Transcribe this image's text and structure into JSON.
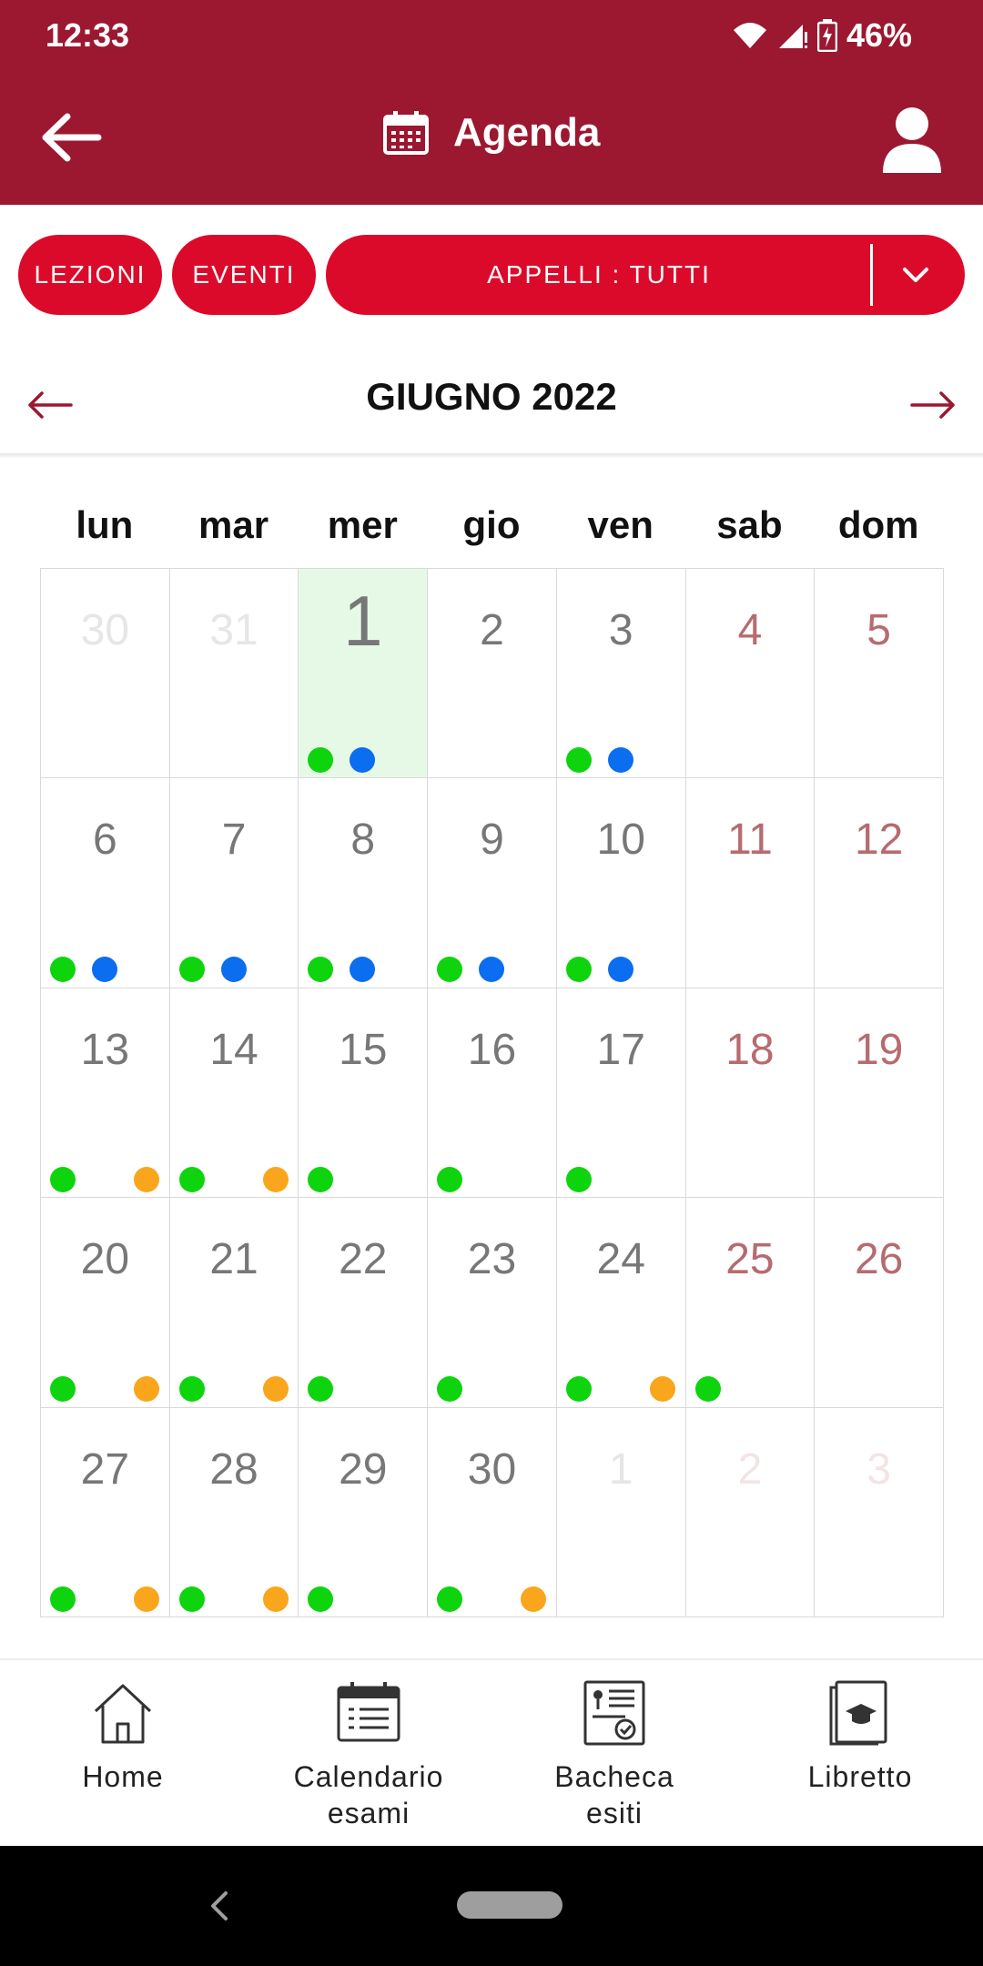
{
  "status_bar": {
    "time": "12:33",
    "battery": "46%"
  },
  "app_bar": {
    "title": "Agenda"
  },
  "filters": {
    "lezioni": "LEZIONI",
    "eventi": "EVENTI",
    "appelli": "APPELLI : TUTTI"
  },
  "month_nav": {
    "title": "GIUGNO 2022"
  },
  "weekdays": [
    "lun",
    "mar",
    "mer",
    "gio",
    "ven",
    "sab",
    "dom"
  ],
  "colors": {
    "lezioni_dot": "#0ed40e",
    "eventi_dot": "#0b6df0",
    "appelli_dot": "#f9a61c",
    "brand": "#9c1730",
    "accent": "#dc0a2a"
  },
  "calendar": {
    "days": [
      {
        "label": "30",
        "outside": true,
        "dots": []
      },
      {
        "label": "31",
        "outside": true,
        "dots": []
      },
      {
        "label": "1",
        "today": true,
        "dots": [
          "green",
          "blue"
        ]
      },
      {
        "label": "2",
        "dots": []
      },
      {
        "label": "3",
        "dots": [
          "green",
          "blue"
        ]
      },
      {
        "label": "4",
        "weekend": true,
        "dots": []
      },
      {
        "label": "5",
        "weekend": true,
        "dots": []
      },
      {
        "label": "6",
        "dots": [
          "green",
          "blue"
        ]
      },
      {
        "label": "7",
        "dots": [
          "green",
          "blue"
        ]
      },
      {
        "label": "8",
        "dots": [
          "green",
          "blue"
        ]
      },
      {
        "label": "9",
        "dots": [
          "green",
          "blue"
        ]
      },
      {
        "label": "10",
        "dots": [
          "green",
          "blue"
        ]
      },
      {
        "label": "11",
        "weekend": true,
        "dots": []
      },
      {
        "label": "12",
        "weekend": true,
        "dots": []
      },
      {
        "label": "13",
        "dots": [
          "green",
          "orange"
        ]
      },
      {
        "label": "14",
        "dots": [
          "green",
          "orange"
        ]
      },
      {
        "label": "15",
        "dots": [
          "green"
        ]
      },
      {
        "label": "16",
        "dots": [
          "green"
        ]
      },
      {
        "label": "17",
        "dots": [
          "green"
        ]
      },
      {
        "label": "18",
        "weekend": true,
        "dots": []
      },
      {
        "label": "19",
        "weekend": true,
        "dots": []
      },
      {
        "label": "20",
        "dots": [
          "green",
          "orange"
        ]
      },
      {
        "label": "21",
        "dots": [
          "green",
          "orange"
        ]
      },
      {
        "label": "22",
        "dots": [
          "green"
        ]
      },
      {
        "label": "23",
        "dots": [
          "green"
        ]
      },
      {
        "label": "24",
        "dots": [
          "green",
          "orange"
        ]
      },
      {
        "label": "25",
        "weekend": true,
        "dots": [
          "green"
        ]
      },
      {
        "label": "26",
        "weekend": true,
        "dots": []
      },
      {
        "label": "27",
        "dots": [
          "green",
          "orange"
        ]
      },
      {
        "label": "28",
        "dots": [
          "green",
          "orange"
        ]
      },
      {
        "label": "29",
        "dots": [
          "green"
        ]
      },
      {
        "label": "30",
        "dots": [
          "green",
          "orange"
        ]
      },
      {
        "label": "1",
        "outside": true,
        "dots": []
      },
      {
        "label": "2",
        "outside": true,
        "weekend": true,
        "dots": []
      },
      {
        "label": "3",
        "outside": true,
        "weekend": true,
        "dots": []
      }
    ]
  },
  "bottom_nav": [
    {
      "label": "Home",
      "icon": "home-icon"
    },
    {
      "label": "Calendario\nesami",
      "icon": "exam-calendar-icon"
    },
    {
      "label": "Bacheca\nesiti",
      "icon": "results-board-icon"
    },
    {
      "label": "Libretto",
      "icon": "booklet-icon"
    }
  ]
}
